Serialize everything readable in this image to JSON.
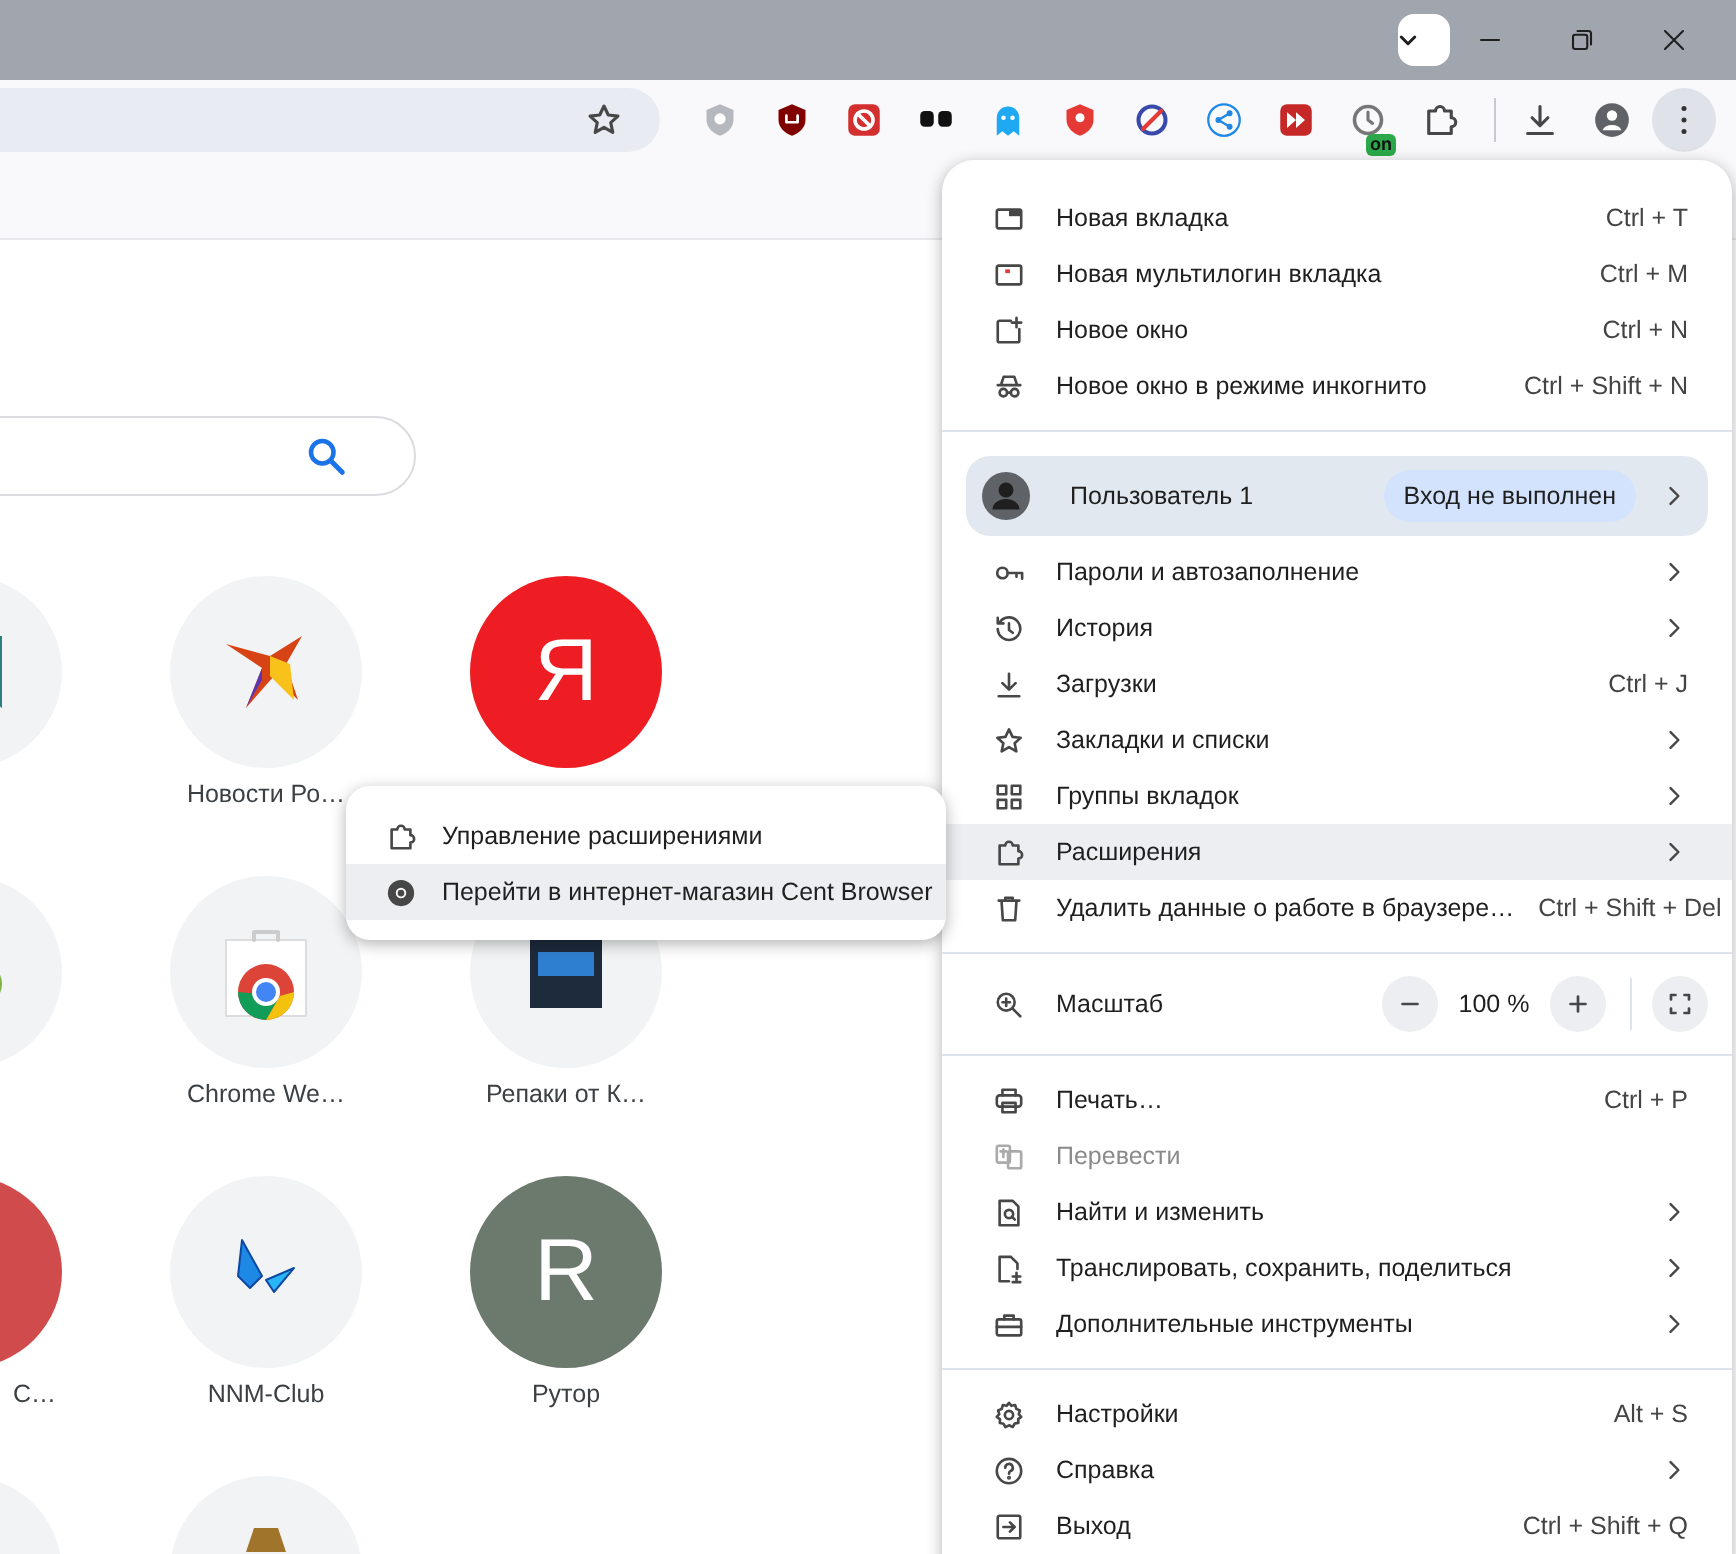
{
  "toolbar": {
    "extension_badge": "on"
  },
  "new_tab_page": {
    "tiles": [
      {
        "kind": "bookmark"
      },
      {
        "kind": "bird",
        "label": "Новости Ро…"
      },
      {
        "kind": "letter",
        "letter": "Я",
        "color": "#ee1d23"
      },
      {
        "kind": "leaf"
      },
      {
        "kind": "store",
        "label": "Chrome We…"
      },
      {
        "kind": "square",
        "label": "Репаки от К…"
      },
      {
        "kind": "blank",
        "label": "С…",
        "color": "#d04b4b"
      },
      {
        "kind": "butterfly",
        "label": "NNM-Club"
      },
      {
        "kind": "letter",
        "letter": "R",
        "label": "Рутор",
        "color": "#6c7a6d"
      },
      {
        "kind": "plain"
      },
      {
        "kind": "figure"
      }
    ]
  },
  "app_menu": {
    "groups": [
      [
        {
          "kind": "command",
          "label": "Новая вкладка",
          "shortcut": "Ctrl + T",
          "submenu": false,
          "disabled": false,
          "highlighted": false
        },
        {
          "kind": "command",
          "label": "Новая мультилогин вкладка",
          "shortcut": "Ctrl + M",
          "submenu": false,
          "disabled": false,
          "highlighted": false
        },
        {
          "kind": "command",
          "label": "Новое окно",
          "shortcut": "Ctrl + N",
          "submenu": false,
          "disabled": false,
          "highlighted": false
        },
        {
          "kind": "command",
          "label": "Новое окно в режиме инкогнито",
          "shortcut": "Ctrl + Shift + N",
          "submenu": false,
          "disabled": false,
          "highlighted": false
        }
      ],
      [
        {
          "kind": "profile",
          "label": "Пользователь 1",
          "status": "Вход не выполнен",
          "submenu": true
        },
        {
          "kind": "command",
          "label": "Пароли и автозаполнение",
          "submenu": true,
          "disabled": false,
          "highlighted": false
        },
        {
          "kind": "command",
          "label": "История",
          "submenu": true,
          "disabled": false,
          "highlighted": false
        },
        {
          "kind": "command",
          "label": "Загрузки",
          "shortcut": "Ctrl + J",
          "submenu": false,
          "disabled": false,
          "highlighted": false
        },
        {
          "kind": "command",
          "label": "Закладки и списки",
          "submenu": true,
          "disabled": false,
          "highlighted": false
        },
        {
          "kind": "command",
          "label": "Группы вкладок",
          "submenu": true,
          "disabled": false,
          "highlighted": false
        },
        {
          "kind": "command",
          "label": "Расширения",
          "submenu": true,
          "disabled": false,
          "highlighted": true
        },
        {
          "kind": "command",
          "label": "Удалить данные о работе в браузере…",
          "shortcut": "Ctrl + Shift + Del",
          "submenu": false,
          "disabled": false,
          "highlighted": false
        }
      ],
      [
        {
          "kind": "zoom",
          "label": "Масштаб",
          "value": "100 %"
        }
      ],
      [
        {
          "kind": "command",
          "label": "Печать…",
          "shortcut": "Ctrl + P",
          "submenu": false,
          "disabled": false,
          "highlighted": false
        },
        {
          "kind": "command",
          "label": "Перевести",
          "submenu": false,
          "disabled": true,
          "highlighted": false
        },
        {
          "kind": "command",
          "label": "Найти и изменить",
          "submenu": true,
          "disabled": false,
          "highlighted": false
        },
        {
          "kind": "command",
          "label": "Транслировать, сохранить, поделиться",
          "submenu": true,
          "disabled": false,
          "highlighted": false
        },
        {
          "kind": "command",
          "label": "Дополнительные инструменты",
          "submenu": true,
          "disabled": false,
          "highlighted": false
        }
      ],
      [
        {
          "kind": "command",
          "label": "Настройки",
          "shortcut": "Alt + S",
          "submenu": false,
          "disabled": false,
          "highlighted": false
        },
        {
          "kind": "command",
          "label": "Справка",
          "submenu": true,
          "disabled": false,
          "highlighted": false
        },
        {
          "kind": "command",
          "label": "Выход",
          "shortcut": "Ctrl + Shift + Q",
          "submenu": false,
          "disabled": false,
          "highlighted": false
        }
      ]
    ]
  },
  "extensions_submenu": {
    "items": [
      {
        "label": "Управление расширениями",
        "highlighted": false
      },
      {
        "label": "Перейти в интернет-магазин Cent Browser",
        "highlighted": true
      }
    ]
  }
}
